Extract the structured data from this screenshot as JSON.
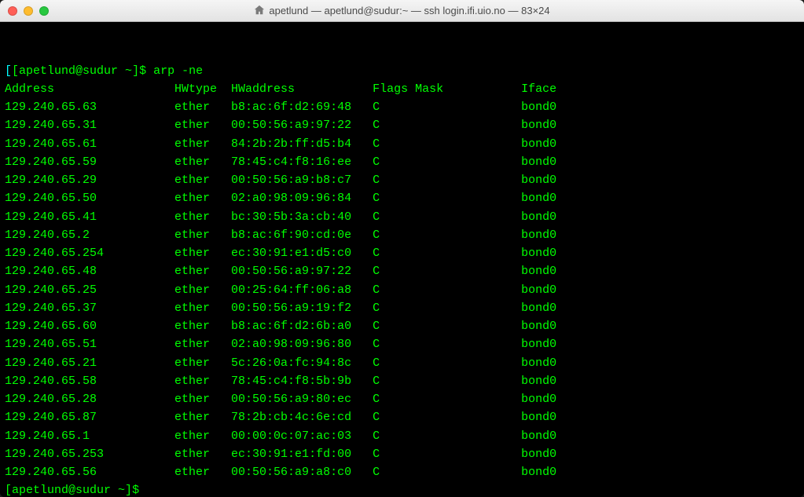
{
  "window": {
    "title_user": "apetlund",
    "title_sep1": " — ",
    "title_ssh": "apetlund@sudur:~",
    "title_sep2": " — ",
    "title_cmd": "ssh login.ifi.uio.no",
    "title_sep3": " — ",
    "title_size": "83×24"
  },
  "prompt": {
    "open": "[",
    "user_host": "apetlund@sudur ~",
    "close": "]",
    "dollar": "$",
    "command": "arp -ne"
  },
  "columns": {
    "address": "Address",
    "hwtype": "HWtype",
    "hwaddress": "HWaddress",
    "flags": "Flags Mask",
    "iface": "Iface"
  },
  "rows": [
    {
      "address": "129.240.65.63",
      "hwtype": "ether",
      "hwaddress": "b8:ac:6f:d2:69:48",
      "flags": "C",
      "iface": "bond0"
    },
    {
      "address": "129.240.65.31",
      "hwtype": "ether",
      "hwaddress": "00:50:56:a9:97:22",
      "flags": "C",
      "iface": "bond0"
    },
    {
      "address": "129.240.65.61",
      "hwtype": "ether",
      "hwaddress": "84:2b:2b:ff:d5:b4",
      "flags": "C",
      "iface": "bond0"
    },
    {
      "address": "129.240.65.59",
      "hwtype": "ether",
      "hwaddress": "78:45:c4:f8:16:ee",
      "flags": "C",
      "iface": "bond0"
    },
    {
      "address": "129.240.65.29",
      "hwtype": "ether",
      "hwaddress": "00:50:56:a9:b8:c7",
      "flags": "C",
      "iface": "bond0"
    },
    {
      "address": "129.240.65.50",
      "hwtype": "ether",
      "hwaddress": "02:a0:98:09:96:84",
      "flags": "C",
      "iface": "bond0"
    },
    {
      "address": "129.240.65.41",
      "hwtype": "ether",
      "hwaddress": "bc:30:5b:3a:cb:40",
      "flags": "C",
      "iface": "bond0"
    },
    {
      "address": "129.240.65.2",
      "hwtype": "ether",
      "hwaddress": "b8:ac:6f:90:cd:0e",
      "flags": "C",
      "iface": "bond0"
    },
    {
      "address": "129.240.65.254",
      "hwtype": "ether",
      "hwaddress": "ec:30:91:e1:d5:c0",
      "flags": "C",
      "iface": "bond0"
    },
    {
      "address": "129.240.65.48",
      "hwtype": "ether",
      "hwaddress": "00:50:56:a9:97:22",
      "flags": "C",
      "iface": "bond0"
    },
    {
      "address": "129.240.65.25",
      "hwtype": "ether",
      "hwaddress": "00:25:64:ff:06:a8",
      "flags": "C",
      "iface": "bond0"
    },
    {
      "address": "129.240.65.37",
      "hwtype": "ether",
      "hwaddress": "00:50:56:a9:19:f2",
      "flags": "C",
      "iface": "bond0"
    },
    {
      "address": "129.240.65.60",
      "hwtype": "ether",
      "hwaddress": "b8:ac:6f:d2:6b:a0",
      "flags": "C",
      "iface": "bond0"
    },
    {
      "address": "129.240.65.51",
      "hwtype": "ether",
      "hwaddress": "02:a0:98:09:96:80",
      "flags": "C",
      "iface": "bond0"
    },
    {
      "address": "129.240.65.21",
      "hwtype": "ether",
      "hwaddress": "5c:26:0a:fc:94:8c",
      "flags": "C",
      "iface": "bond0"
    },
    {
      "address": "129.240.65.58",
      "hwtype": "ether",
      "hwaddress": "78:45:c4:f8:5b:9b",
      "flags": "C",
      "iface": "bond0"
    },
    {
      "address": "129.240.65.28",
      "hwtype": "ether",
      "hwaddress": "00:50:56:a9:80:ec",
      "flags": "C",
      "iface": "bond0"
    },
    {
      "address": "129.240.65.87",
      "hwtype": "ether",
      "hwaddress": "78:2b:cb:4c:6e:cd",
      "flags": "C",
      "iface": "bond0"
    },
    {
      "address": "129.240.65.1",
      "hwtype": "ether",
      "hwaddress": "00:00:0c:07:ac:03",
      "flags": "C",
      "iface": "bond0"
    },
    {
      "address": "129.240.65.253",
      "hwtype": "ether",
      "hwaddress": "ec:30:91:e1:fd:00",
      "flags": "C",
      "iface": "bond0"
    },
    {
      "address": "129.240.65.56",
      "hwtype": "ether",
      "hwaddress": "00:50:56:a9:a8:c0",
      "flags": "C",
      "iface": "bond0"
    }
  ],
  "widths": {
    "address": 24,
    "hwtype": 8,
    "hwaddress": 20,
    "flags": 21
  }
}
